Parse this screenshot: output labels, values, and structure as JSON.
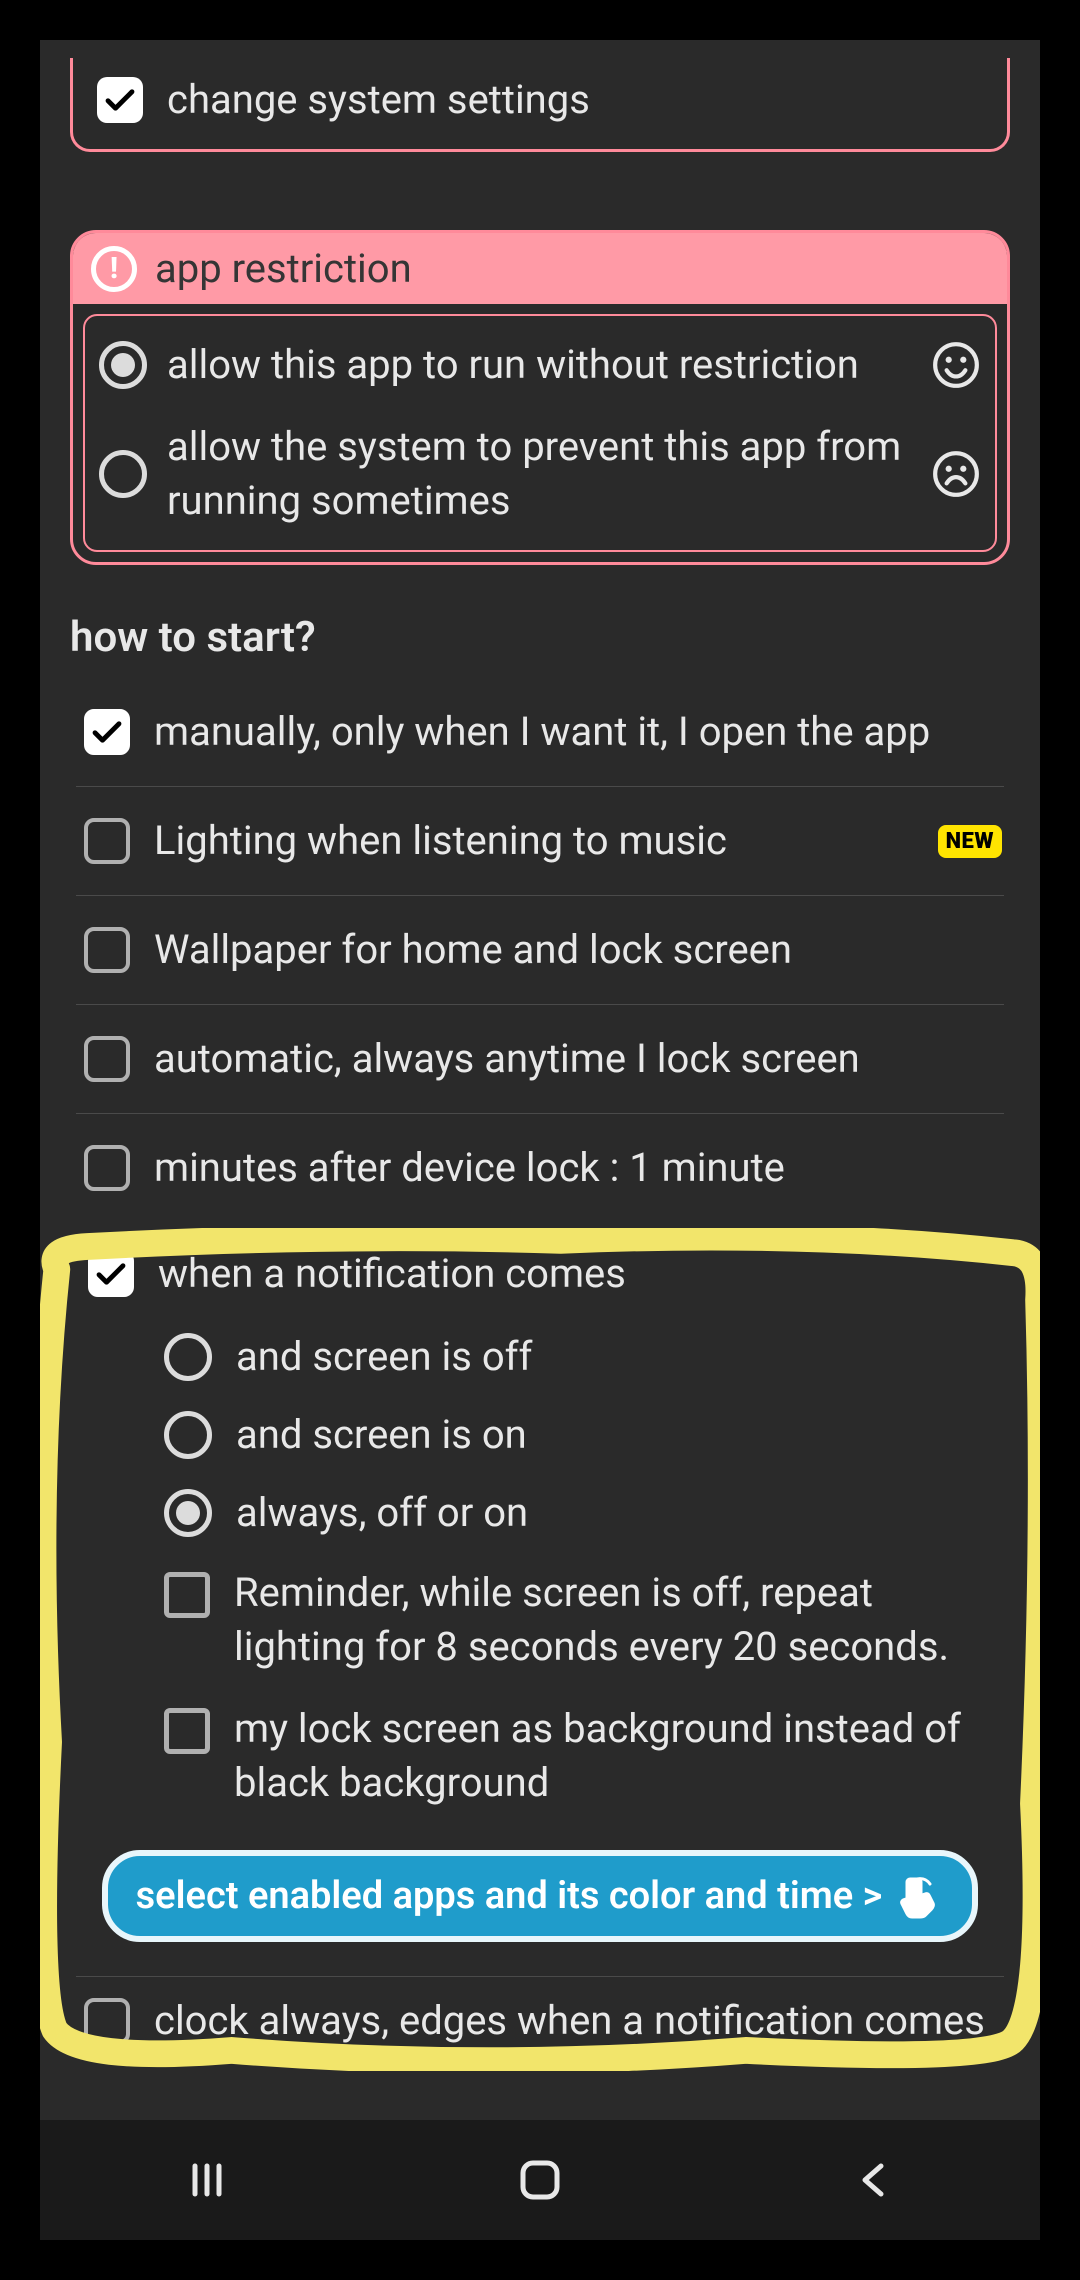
{
  "change_system_settings": {
    "label": "change system settings",
    "checked": true
  },
  "app_restriction": {
    "title": "app restriction",
    "options": [
      {
        "label": "allow this app to run without restriction",
        "selected": true,
        "mood": "happy"
      },
      {
        "label": "allow the system to prevent this app from running sometimes",
        "selected": false,
        "mood": "sad"
      }
    ]
  },
  "how_to_start": {
    "title": "how to start?",
    "items": [
      {
        "label": "manually, only when I want it, I open the app",
        "checked": true
      },
      {
        "label": "Lighting when listening to music",
        "checked": false,
        "badge": "NEW"
      },
      {
        "label": "Wallpaper for home and lock screen",
        "checked": false
      },
      {
        "label": "automatic, always anytime I lock screen",
        "checked": false
      },
      {
        "label": "minutes after device lock : 1 minute",
        "checked": false
      }
    ]
  },
  "notification": {
    "label": "when a notification comes",
    "checked": true,
    "radios": [
      {
        "label": "and screen is off",
        "selected": false
      },
      {
        "label": "and screen is on",
        "selected": false
      },
      {
        "label": "always, off or on",
        "selected": true
      }
    ],
    "checks": [
      {
        "label": "Reminder, while screen is off, repeat lighting for 8 seconds every 20 seconds.",
        "checked": false
      },
      {
        "label": "my lock screen as background instead of black background",
        "checked": false
      }
    ],
    "cta": "select enabled apps and its color and time >"
  },
  "last_item": {
    "label": "clock always, edges when a notification comes",
    "checked": false
  },
  "colors": {
    "accent_pink": "#ff8a9a",
    "accent_blue": "#1f9ccb",
    "highlight_yellow": "#f2e56b",
    "new_badge": "#ffe400"
  }
}
